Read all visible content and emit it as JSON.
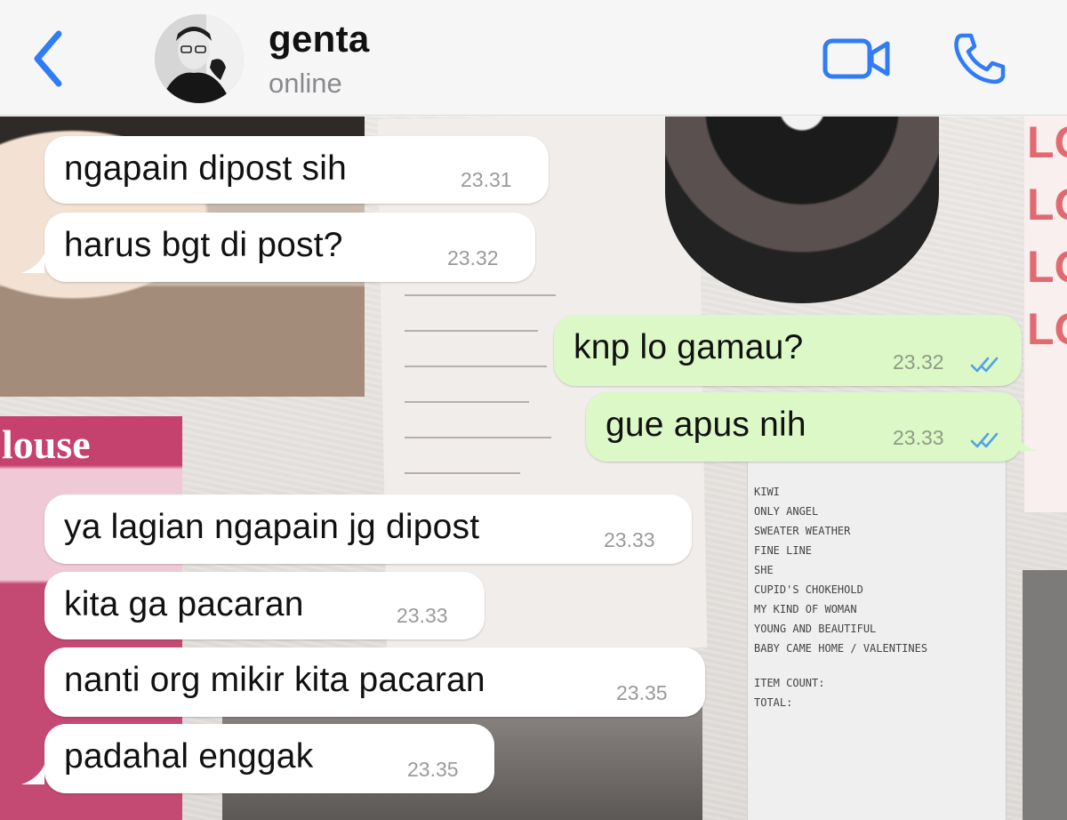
{
  "header": {
    "back_icon": "chevron-left-icon",
    "contact_name": "genta",
    "contact_status": "online",
    "video_icon": "video-camera-icon",
    "call_icon": "phone-icon",
    "accent_color": "#2f7cf6"
  },
  "messages": [
    {
      "direction": "in",
      "text": "ngapain dipost sih",
      "time": "23.31"
    },
    {
      "direction": "in",
      "text": "harus bgt di post?",
      "time": "23.32"
    },
    {
      "direction": "out",
      "text": "knp lo gamau?",
      "time": "23.32",
      "status_icon": "double-check-read-icon"
    },
    {
      "direction": "out",
      "text": "gue apus nih",
      "time": "23.33",
      "status_icon": "double-check-read-icon"
    },
    {
      "direction": "in",
      "text": "ya lagian ngapain jg dipost",
      "time": "23.33"
    },
    {
      "direction": "in",
      "text": "kita ga pacaran",
      "time": "23.33"
    },
    {
      "direction": "in",
      "text": "nanti org mikir kita pacaran",
      "time": "23.35"
    },
    {
      "direction": "in",
      "text": "padahal enggak",
      "time": "23.35"
    }
  ],
  "wallpaper": {
    "poster_letters": [
      "LO",
      "LO",
      "LO",
      "LO"
    ],
    "house_card_text": "louse",
    "receipt_lines": [
      "KIWI",
      "ONLY ANGEL",
      "SWEATER WEATHER",
      "FINE LINE",
      "SHE",
      "CUPID'S CHOKEHOLD",
      "MY KIND OF WOMAN",
      "YOUNG AND BEAUTIFUL",
      "BABY CAME HOME / VALENTINES",
      "ITEM COUNT:",
      "TOTAL:"
    ]
  },
  "colors": {
    "incoming_bubble": "#ffffff",
    "outgoing_bubble": "#dcf8c6",
    "read_ticks": "#4fa3e8"
  }
}
